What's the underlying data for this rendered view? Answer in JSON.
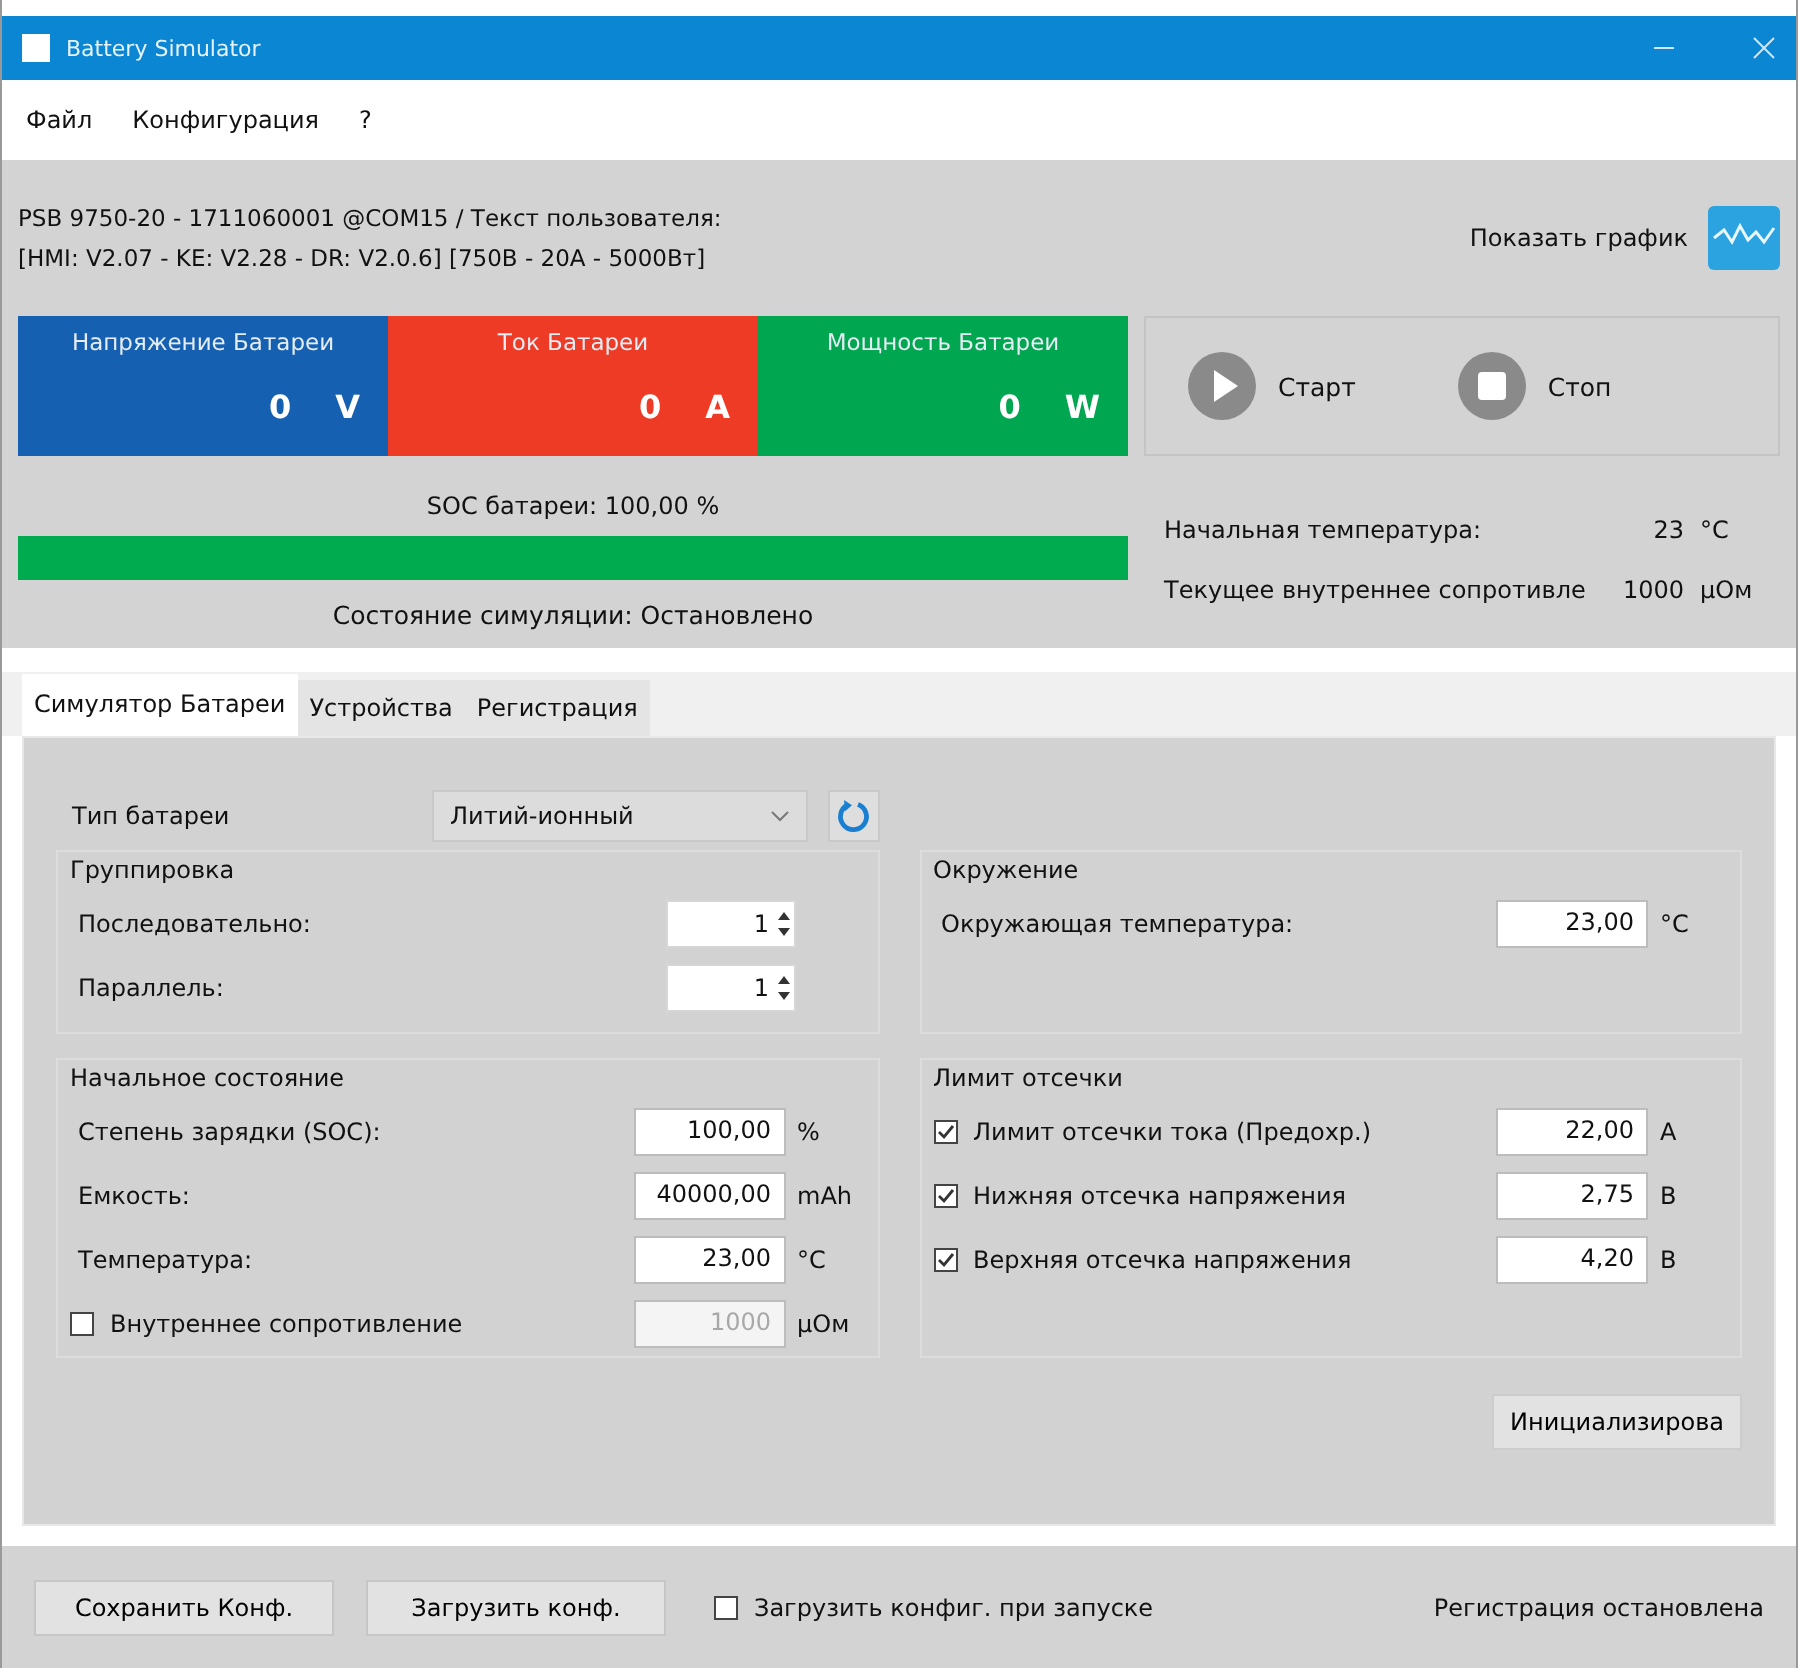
{
  "window": {
    "title": "Battery Simulator"
  },
  "menu": [
    {
      "label": "Файл"
    },
    {
      "label": "Конфигурация"
    },
    {
      "label": "?"
    }
  ],
  "device_info": {
    "line1": "PSB 9750-20 - 1711060001 @COM15 / Текст пользователя:",
    "line2": "[HMI: V2.07 - KE: V2.28 - DR: V2.0.6] [750В - 20А - 5000Вт]"
  },
  "show_chart": {
    "label": "Показать график"
  },
  "meters": [
    {
      "label": "Напряжение Батареи",
      "value": "0",
      "unit": "V",
      "color": "#1560b0"
    },
    {
      "label": "Ток Батареи",
      "value": "0",
      "unit": "A",
      "color": "#ee3b26"
    },
    {
      "label": "Мощность Батареи",
      "value": "0",
      "unit": "W",
      "color": "#00a650"
    }
  ],
  "run_controls": [
    {
      "label": "Старт",
      "kind": "start"
    },
    {
      "label": "Стоп",
      "kind": "stop"
    }
  ],
  "soc": {
    "label": "SOC батареи: 100,00 %",
    "level": 1
  },
  "simulation_status": "Состояние симуляции: Остановлено",
  "readings": [
    {
      "label": "Начальная температура:",
      "value": "23",
      "unit": "°C"
    },
    {
      "label": "Текущее внутреннее сопротивле",
      "value": "1000",
      "unit": "µOм"
    }
  ],
  "tabs": [
    {
      "label": "Симулятор Батареи",
      "selected": true
    },
    {
      "label": "Устройства",
      "selected": false
    },
    {
      "label": "Регистрация",
      "selected": false
    }
  ],
  "battery_type": {
    "label": "Тип батареи",
    "value": "Литий-ионный"
  },
  "grouping": {
    "title": "Группировка",
    "rows": [
      {
        "label": "Последовательно:",
        "value": "1"
      },
      {
        "label": "Параллель:",
        "value": "1"
      }
    ]
  },
  "environment": {
    "title": "Окружение",
    "rows": [
      {
        "label": "Окружающая температура:",
        "value": "23,00",
        "unit": "°C"
      }
    ]
  },
  "initial_state": {
    "title": "Начальное состояние",
    "rows": [
      {
        "kind": "field",
        "label": "Степень зарядки (SOC):",
        "value": "100,00",
        "unit": "%"
      },
      {
        "kind": "field",
        "label": "Емкость:",
        "value": "40000,00",
        "unit": "mAh"
      },
      {
        "kind": "field",
        "label": "Температура:",
        "value": "23,00",
        "unit": "°C"
      },
      {
        "kind": "check",
        "label": "Внутреннее сопротивление",
        "checked": false,
        "value": "1000",
        "unit": "µOм"
      }
    ]
  },
  "cutoff": {
    "title": "Лимит отсечки",
    "rows": [
      {
        "kind": "check",
        "label": "Лимит отсечки тока (Предохр.)",
        "checked": true,
        "value": "22,00",
        "unit": "A"
      },
      {
        "kind": "check",
        "label": "Нижняя отсечка напряжения",
        "checked": true,
        "value": "2,75",
        "unit": "В"
      },
      {
        "kind": "check",
        "label": "Верхняя отсечка напряжения",
        "checked": true,
        "value": "4,20",
        "unit": "В"
      }
    ]
  },
  "init_button": "Инициализирова",
  "footer": {
    "buttons": [
      "Сохранить Конф.",
      "Загрузить конф."
    ],
    "autoload": {
      "label": "Загрузить конфиг. при запуске",
      "checked": false
    },
    "status": "Регистрация остановлена"
  }
}
